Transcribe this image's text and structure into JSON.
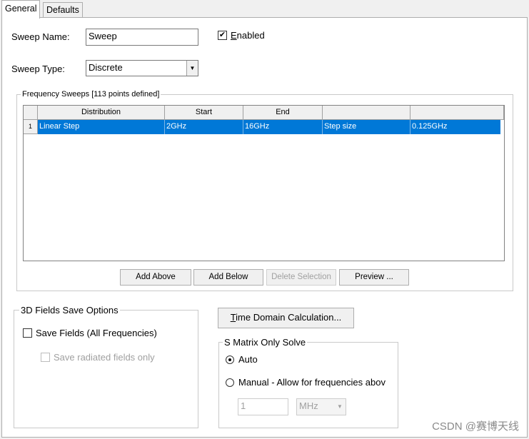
{
  "tabs": [
    "General",
    "Defaults"
  ],
  "sweep_name": {
    "label": "Sweep Name:",
    "value": "Sweep"
  },
  "enabled": {
    "label": "Enabled",
    "checked": true
  },
  "sweep_type": {
    "label": "Sweep Type:",
    "value": "Discrete"
  },
  "frequency_sweeps": {
    "title": "Frequency Sweeps [113 points defined]",
    "columns": [
      "Distribution",
      "Start",
      "End",
      "",
      ""
    ],
    "rows": [
      {
        "index": "1",
        "cells": [
          "Linear Step",
          "2GHz",
          "16GHz",
          "Step size",
          "0.125GHz"
        ],
        "selected": true
      }
    ]
  },
  "sweep_buttons": {
    "add_above": "Add Above",
    "add_below": "Add Below",
    "delete_selection": "Delete Selection",
    "preview": "Preview ..."
  },
  "fields_save": {
    "title": "3D Fields Save Options",
    "save_fields": "Save Fields (All Frequencies)",
    "save_radiated": "Save radiated fields only"
  },
  "time_domain_button": "Time Domain Calculation...",
  "s_matrix": {
    "title": "S Matrix Only Solve",
    "auto": "Auto",
    "manual": "Manual -  Allow for frequencies abov",
    "freq_value": "1",
    "freq_unit": "MHz"
  },
  "watermark": "CSDN @赛博天线"
}
